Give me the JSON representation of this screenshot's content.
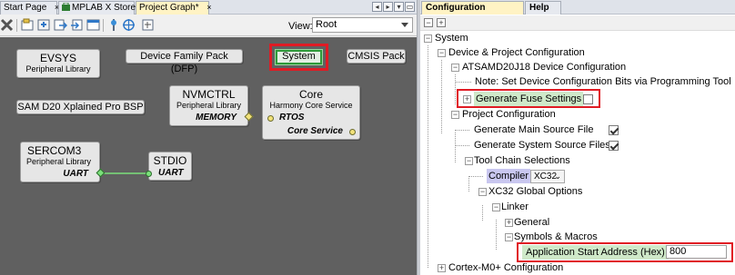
{
  "left_tabs": [
    {
      "label": "Start Page"
    },
    {
      "label": "MPLAB X Store"
    },
    {
      "label": "Project Graph*"
    }
  ],
  "view": {
    "label": "View:",
    "value": "Root"
  },
  "nodes": {
    "evsys": {
      "title": "EVSYS",
      "subtitle": "Peripheral Library"
    },
    "dfp": {
      "title": "Device Family Pack (DFP)"
    },
    "system": {
      "title": "System"
    },
    "cmsis": {
      "title": "CMSIS Pack"
    },
    "bsp": {
      "title": "SAM D20 Xplained Pro BSP"
    },
    "nvmctrl": {
      "title": "NVMCTRL",
      "subtitle": "Peripheral Library",
      "port": "MEMORY"
    },
    "core": {
      "title": "Core",
      "subtitle": "Harmony Core Service",
      "port1": "RTOS",
      "port2": "Core Service"
    },
    "sercom3": {
      "title": "SERCOM3",
      "subtitle": "Peripheral Library",
      "port": "UART"
    },
    "stdio": {
      "title": "STDIO",
      "port": "UART"
    }
  },
  "right_tabs": [
    {
      "label": "Configuration Options*"
    },
    {
      "label": "Help"
    }
  ],
  "tree": {
    "system": "System",
    "device_project_config": "Device & Project Configuration",
    "device_config": "ATSAMD20J18 Device Configuration",
    "note": "Note: Set Device Configuration Bits via Programming Tool",
    "generate_fuse": "Generate Fuse Settings",
    "project_config": "Project Configuration",
    "gen_main": "Generate Main Source File",
    "gen_system": "Generate System Source Files",
    "toolchain": "Tool Chain Selections",
    "compiler_label": "Compiler",
    "compiler_value": "XC32",
    "xc32_options": "XC32 Global Options",
    "linker": "Linker",
    "general": "General",
    "symbols": "Symbols & Macros",
    "app_start_label": "Application Start Address (Hex)",
    "app_start_value": "800",
    "cortex": "Cortex-M0+ Configuration"
  },
  "checkboxes": {
    "generate_fuse": false,
    "gen_main": true,
    "gen_system": true
  }
}
